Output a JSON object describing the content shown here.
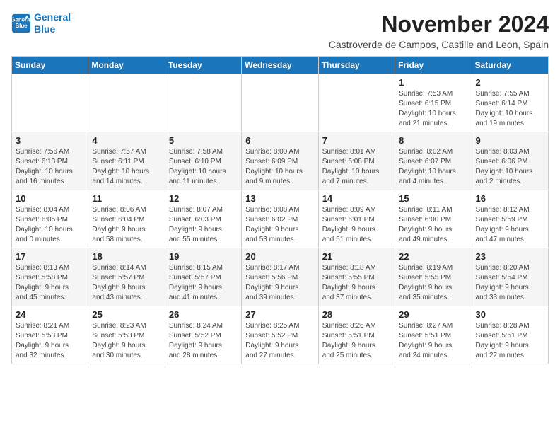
{
  "logo": {
    "line1": "General",
    "line2": "Blue"
  },
  "title": "November 2024",
  "subtitle": "Castroverde de Campos, Castille and Leon, Spain",
  "weekdays": [
    "Sunday",
    "Monday",
    "Tuesday",
    "Wednesday",
    "Thursday",
    "Friday",
    "Saturday"
  ],
  "weeks": [
    [
      {
        "day": "",
        "info": ""
      },
      {
        "day": "",
        "info": ""
      },
      {
        "day": "",
        "info": ""
      },
      {
        "day": "",
        "info": ""
      },
      {
        "day": "",
        "info": ""
      },
      {
        "day": "1",
        "info": "Sunrise: 7:53 AM\nSunset: 6:15 PM\nDaylight: 10 hours\nand 21 minutes."
      },
      {
        "day": "2",
        "info": "Sunrise: 7:55 AM\nSunset: 6:14 PM\nDaylight: 10 hours\nand 19 minutes."
      }
    ],
    [
      {
        "day": "3",
        "info": "Sunrise: 7:56 AM\nSunset: 6:13 PM\nDaylight: 10 hours\nand 16 minutes."
      },
      {
        "day": "4",
        "info": "Sunrise: 7:57 AM\nSunset: 6:11 PM\nDaylight: 10 hours\nand 14 minutes."
      },
      {
        "day": "5",
        "info": "Sunrise: 7:58 AM\nSunset: 6:10 PM\nDaylight: 10 hours\nand 11 minutes."
      },
      {
        "day": "6",
        "info": "Sunrise: 8:00 AM\nSunset: 6:09 PM\nDaylight: 10 hours\nand 9 minutes."
      },
      {
        "day": "7",
        "info": "Sunrise: 8:01 AM\nSunset: 6:08 PM\nDaylight: 10 hours\nand 7 minutes."
      },
      {
        "day": "8",
        "info": "Sunrise: 8:02 AM\nSunset: 6:07 PM\nDaylight: 10 hours\nand 4 minutes."
      },
      {
        "day": "9",
        "info": "Sunrise: 8:03 AM\nSunset: 6:06 PM\nDaylight: 10 hours\nand 2 minutes."
      }
    ],
    [
      {
        "day": "10",
        "info": "Sunrise: 8:04 AM\nSunset: 6:05 PM\nDaylight: 10 hours\nand 0 minutes."
      },
      {
        "day": "11",
        "info": "Sunrise: 8:06 AM\nSunset: 6:04 PM\nDaylight: 9 hours\nand 58 minutes."
      },
      {
        "day": "12",
        "info": "Sunrise: 8:07 AM\nSunset: 6:03 PM\nDaylight: 9 hours\nand 55 minutes."
      },
      {
        "day": "13",
        "info": "Sunrise: 8:08 AM\nSunset: 6:02 PM\nDaylight: 9 hours\nand 53 minutes."
      },
      {
        "day": "14",
        "info": "Sunrise: 8:09 AM\nSunset: 6:01 PM\nDaylight: 9 hours\nand 51 minutes."
      },
      {
        "day": "15",
        "info": "Sunrise: 8:11 AM\nSunset: 6:00 PM\nDaylight: 9 hours\nand 49 minutes."
      },
      {
        "day": "16",
        "info": "Sunrise: 8:12 AM\nSunset: 5:59 PM\nDaylight: 9 hours\nand 47 minutes."
      }
    ],
    [
      {
        "day": "17",
        "info": "Sunrise: 8:13 AM\nSunset: 5:58 PM\nDaylight: 9 hours\nand 45 minutes."
      },
      {
        "day": "18",
        "info": "Sunrise: 8:14 AM\nSunset: 5:57 PM\nDaylight: 9 hours\nand 43 minutes."
      },
      {
        "day": "19",
        "info": "Sunrise: 8:15 AM\nSunset: 5:57 PM\nDaylight: 9 hours\nand 41 minutes."
      },
      {
        "day": "20",
        "info": "Sunrise: 8:17 AM\nSunset: 5:56 PM\nDaylight: 9 hours\nand 39 minutes."
      },
      {
        "day": "21",
        "info": "Sunrise: 8:18 AM\nSunset: 5:55 PM\nDaylight: 9 hours\nand 37 minutes."
      },
      {
        "day": "22",
        "info": "Sunrise: 8:19 AM\nSunset: 5:55 PM\nDaylight: 9 hours\nand 35 minutes."
      },
      {
        "day": "23",
        "info": "Sunrise: 8:20 AM\nSunset: 5:54 PM\nDaylight: 9 hours\nand 33 minutes."
      }
    ],
    [
      {
        "day": "24",
        "info": "Sunrise: 8:21 AM\nSunset: 5:53 PM\nDaylight: 9 hours\nand 32 minutes."
      },
      {
        "day": "25",
        "info": "Sunrise: 8:23 AM\nSunset: 5:53 PM\nDaylight: 9 hours\nand 30 minutes."
      },
      {
        "day": "26",
        "info": "Sunrise: 8:24 AM\nSunset: 5:52 PM\nDaylight: 9 hours\nand 28 minutes."
      },
      {
        "day": "27",
        "info": "Sunrise: 8:25 AM\nSunset: 5:52 PM\nDaylight: 9 hours\nand 27 minutes."
      },
      {
        "day": "28",
        "info": "Sunrise: 8:26 AM\nSunset: 5:51 PM\nDaylight: 9 hours\nand 25 minutes."
      },
      {
        "day": "29",
        "info": "Sunrise: 8:27 AM\nSunset: 5:51 PM\nDaylight: 9 hours\nand 24 minutes."
      },
      {
        "day": "30",
        "info": "Sunrise: 8:28 AM\nSunset: 5:51 PM\nDaylight: 9 hours\nand 22 minutes."
      }
    ]
  ]
}
